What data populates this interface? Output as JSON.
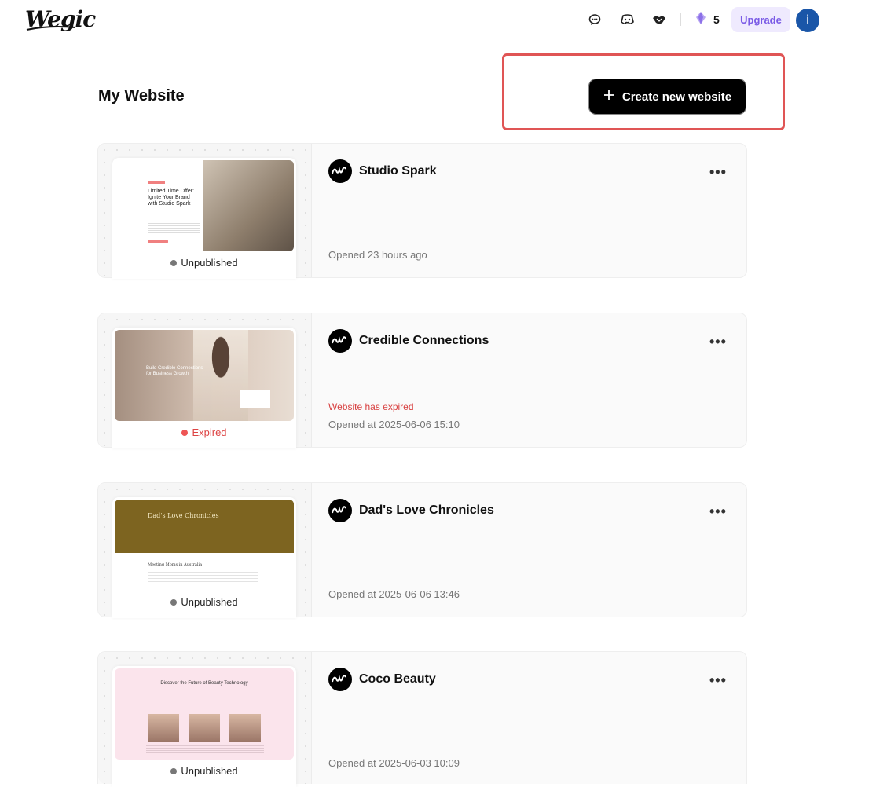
{
  "header": {
    "logo": "Wegic",
    "credits": "5",
    "upgrade_label": "Upgrade",
    "avatar_initial": "i",
    "icons": [
      "chat-icon",
      "discord-icon",
      "handshake-icon",
      "gem-icon"
    ]
  },
  "main": {
    "title": "My Website",
    "create_label": "Create new website"
  },
  "sites": [
    {
      "name": "Studio Spark",
      "status": "Unpublished",
      "expired_note": "",
      "opened": "Opened 23 hours ago",
      "thumb_title": "Limited Time Offer: Ignite Your Brand with Studio Spark"
    },
    {
      "name": "Credible Connections",
      "status": "Expired",
      "expired_note": "Website has expired",
      "opened": "Opened at 2025-06-06 15:10",
      "thumb_title": "Build Credible Connections for Business Growth"
    },
    {
      "name": "Dad's Love Chronicles",
      "status": "Unpublished",
      "expired_note": "",
      "opened": "Opened at 2025-06-06 13:46",
      "thumb_title": "Dad's Love Chronicles",
      "thumb_sub": "Meeting Moms in Australia"
    },
    {
      "name": "Coco Beauty",
      "status": "Unpublished",
      "expired_note": "",
      "opened": "Opened at 2025-06-03 10:09",
      "thumb_title": "Discover the Future of Beauty Technology"
    }
  ],
  "colors": {
    "accent": "#7a5be6",
    "upgrade_bg": "#efeafe",
    "avatar_bg": "#1a56a8",
    "expired": "#d84040",
    "highlight": "#e05555"
  }
}
